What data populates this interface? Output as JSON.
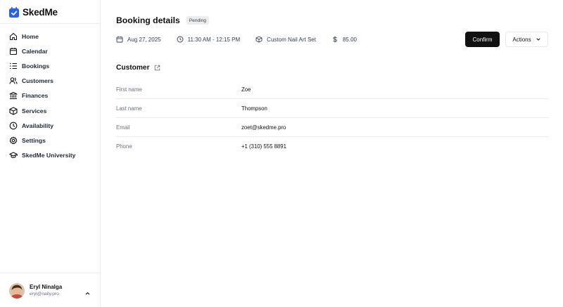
{
  "app": {
    "name": "SkedMe"
  },
  "sidebar": {
    "items": [
      {
        "label": "Home",
        "icon": "home-icon"
      },
      {
        "label": "Calendar",
        "icon": "calendar-icon"
      },
      {
        "label": "Bookings",
        "icon": "list-icon"
      },
      {
        "label": "Customers",
        "icon": "users-icon"
      },
      {
        "label": "Finances",
        "icon": "bank-icon"
      },
      {
        "label": "Services",
        "icon": "box-icon"
      },
      {
        "label": "Availability",
        "icon": "clock-icon"
      },
      {
        "label": "Settings",
        "icon": "gear-icon"
      },
      {
        "label": "SkedMe University",
        "icon": "graduation-cap-icon"
      }
    ]
  },
  "user": {
    "name": "Eryl Ninalga",
    "email": "eryl@naily.pro"
  },
  "booking": {
    "title": "Booking details",
    "status": "Pending",
    "date": "Aug 27, 2025",
    "time": "11:30 AM - 12:15 PM",
    "service": "Custom Nail Art Set",
    "price": "85.00",
    "confirm_label": "Confirm",
    "actions_label": "Actions"
  },
  "customer": {
    "section_title": "Customer",
    "fields": [
      {
        "label": "First name",
        "value": "Zoe"
      },
      {
        "label": "Last name",
        "value": "Thompson"
      },
      {
        "label": "Email",
        "value": "zoet@skedme.pro"
      },
      {
        "label": "Phone",
        "value": "+1 (310) 555 8891"
      }
    ]
  },
  "colors": {
    "brand": "#2563eb",
    "primary_button": "#111111",
    "badge_bg": "#ececec"
  }
}
